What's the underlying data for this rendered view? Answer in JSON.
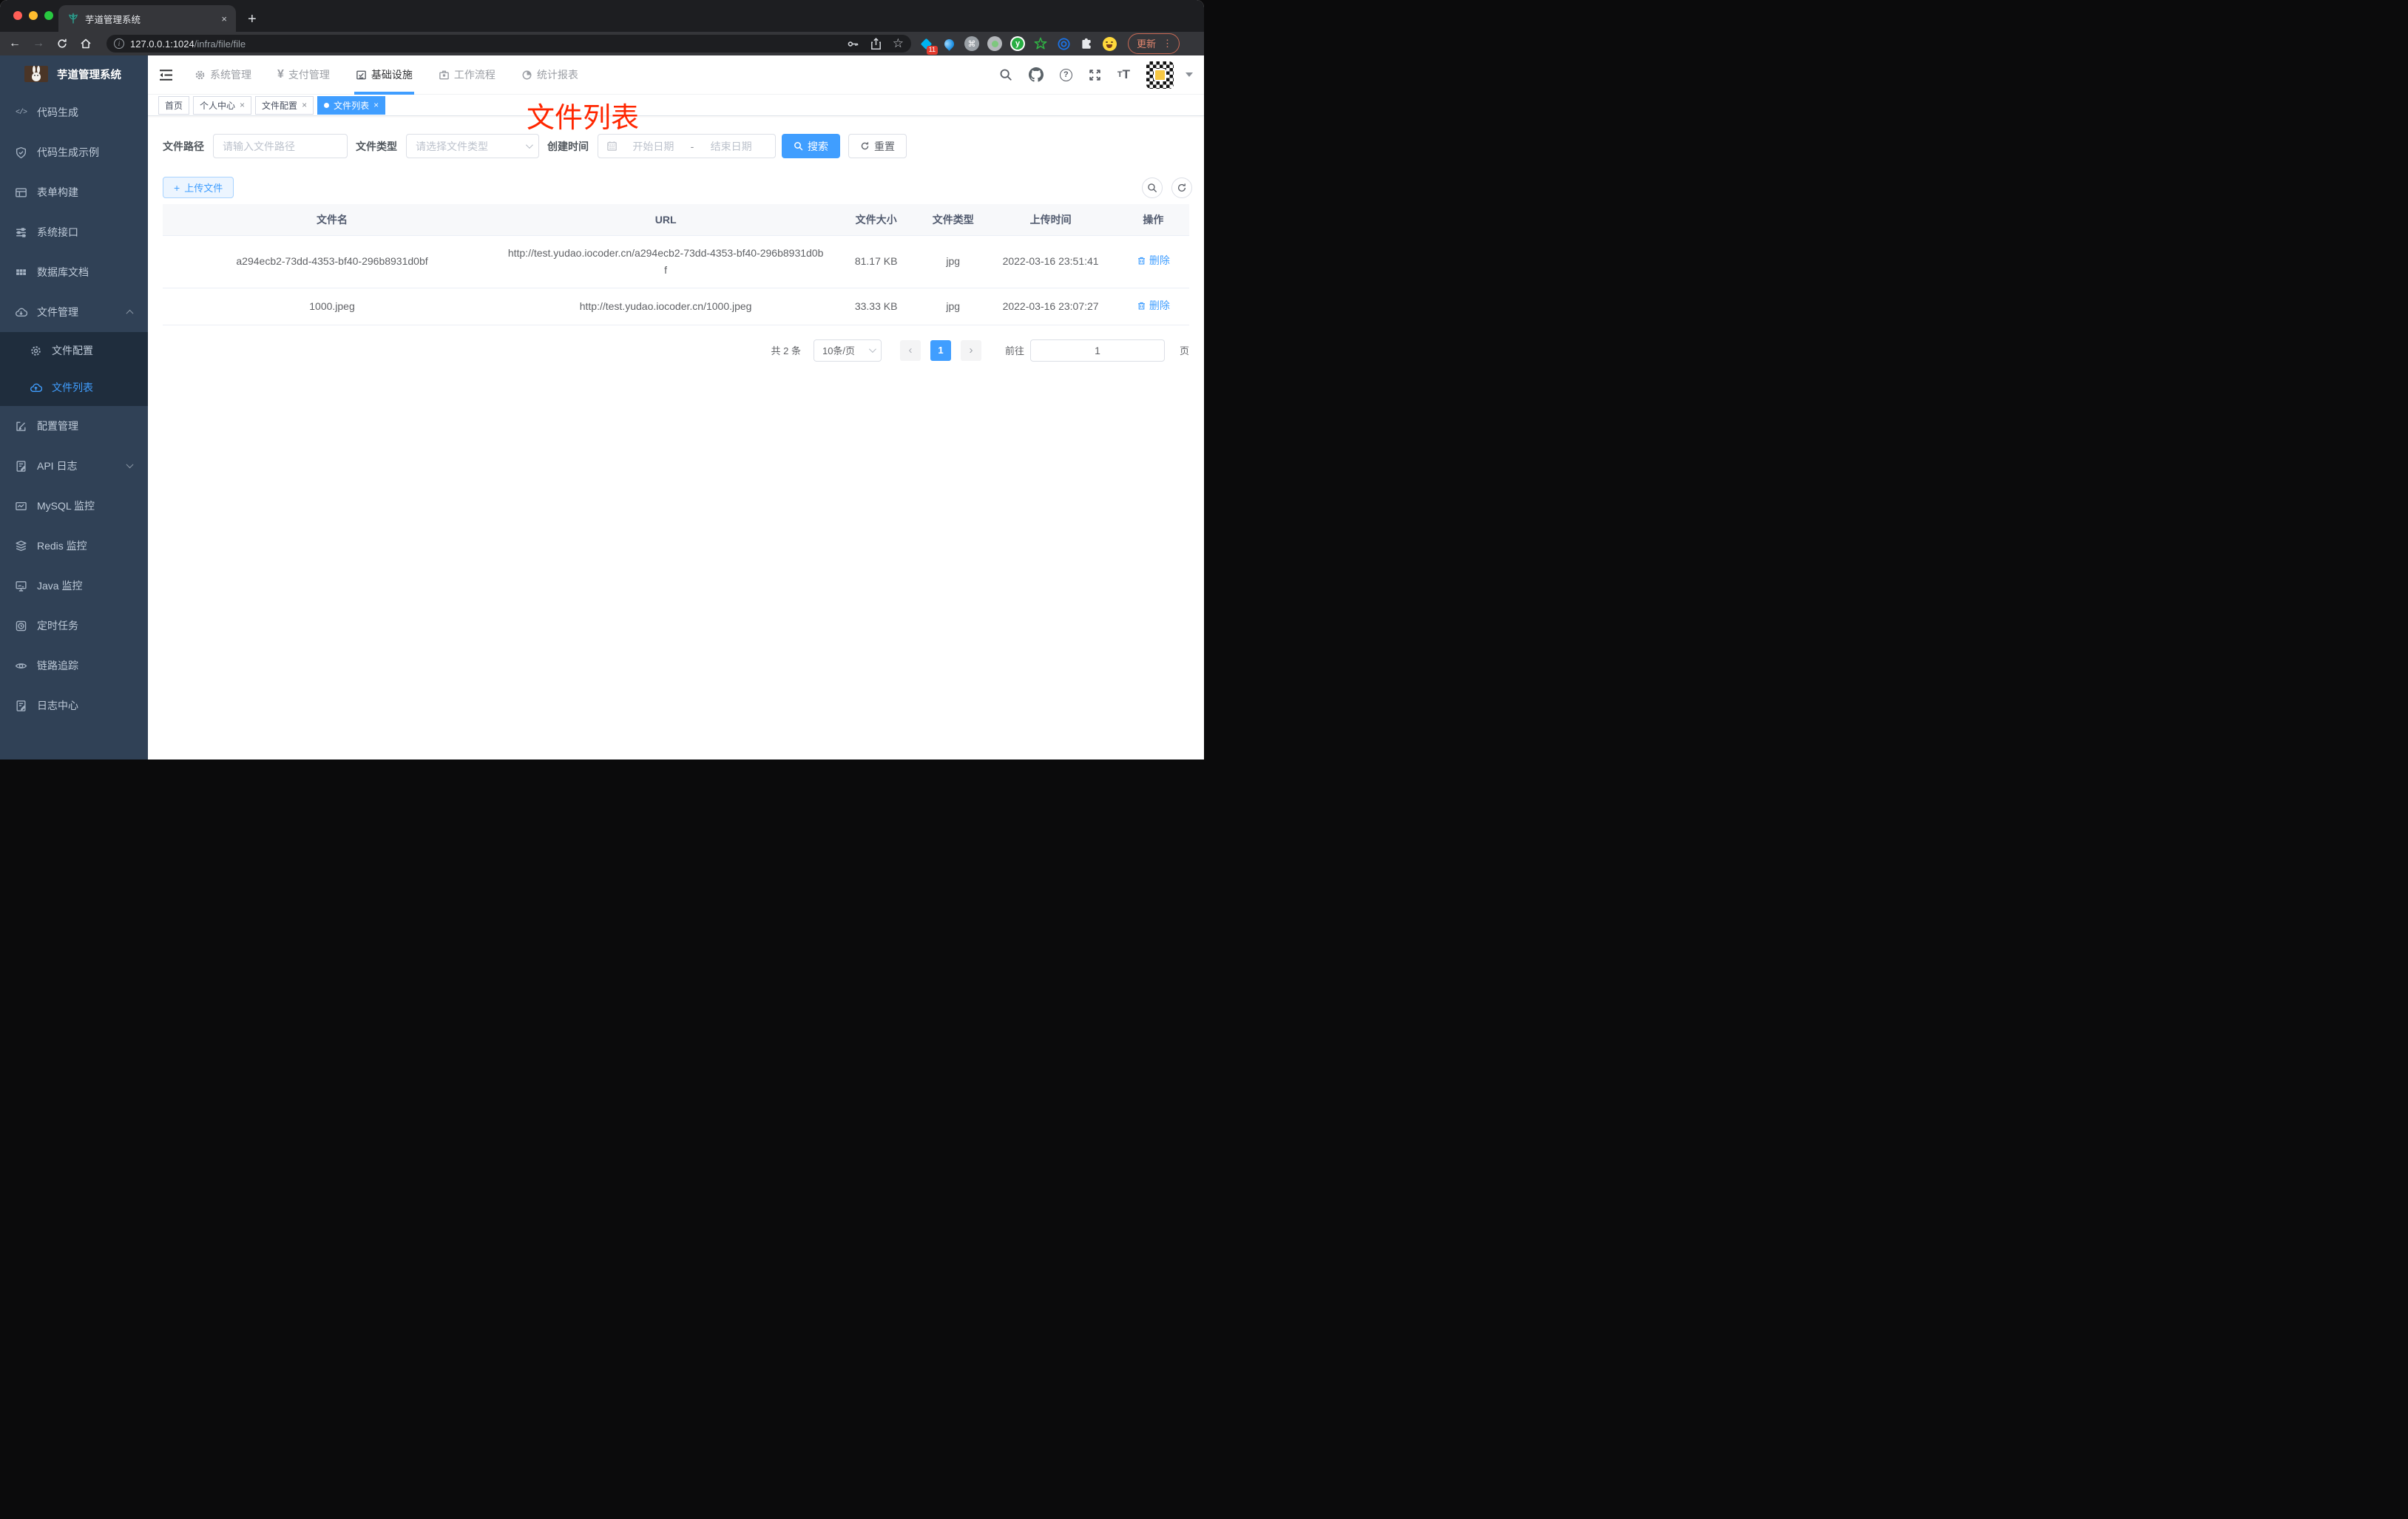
{
  "browser": {
    "tab_title": "芋道管理系统",
    "url_host": "127.0.0.1:1024",
    "url_path": "/infra/file/file",
    "update_label": "更新",
    "extension_badge": "11"
  },
  "icons": {
    "close": "×",
    "plus": "+",
    "back_arrow": "←",
    "forward_arrow": "→",
    "menu_dots": "⋮",
    "command": "⌘",
    "star": "☆",
    "question": "?",
    "info": "i",
    "yen": "¥",
    "dash": "-",
    "prev": "‹",
    "next": "›",
    "text_big": "T",
    "text_small": "T",
    "ext_letter": "y",
    "code": "</>"
  },
  "sidebar": {
    "title": "芋道管理系统",
    "menu": [
      {
        "label": "代码生成"
      },
      {
        "label": "代码生成示例"
      },
      {
        "label": "表单构建"
      },
      {
        "label": "系统接口"
      },
      {
        "label": "数据库文档"
      },
      {
        "label": "文件管理"
      },
      {
        "label": "文件配置"
      },
      {
        "label": "文件列表"
      },
      {
        "label": "配置管理"
      },
      {
        "label": "API 日志"
      },
      {
        "label": "MySQL 监控"
      },
      {
        "label": "Redis 监控"
      },
      {
        "label": "Java 监控"
      },
      {
        "label": "定时任务"
      },
      {
        "label": "链路追踪"
      },
      {
        "label": "日志中心"
      }
    ]
  },
  "topnav": {
    "items": [
      {
        "label": "系统管理"
      },
      {
        "label": "支付管理"
      },
      {
        "label": "基础设施"
      },
      {
        "label": "工作流程"
      },
      {
        "label": "统计报表"
      }
    ]
  },
  "tags": [
    {
      "label": "首页"
    },
    {
      "label": "个人中心"
    },
    {
      "label": "文件配置"
    },
    {
      "label": "文件列表"
    }
  ],
  "annotation": {
    "text": "文件列表",
    "color": "#ff2600"
  },
  "filters": {
    "path_label": "文件路径",
    "path_placeholder": "请输入文件路径",
    "type_label": "文件类型",
    "type_placeholder": "请选择文件类型",
    "time_label": "创建时间",
    "start_placeholder": "开始日期",
    "range_separator": "-",
    "end_placeholder": "结束日期",
    "search_label": "搜索",
    "reset_label": "重置"
  },
  "toolbar": {
    "upload_label": "上传文件"
  },
  "table": {
    "headers": [
      "文件名",
      "URL",
      "文件大小",
      "文件类型",
      "上传时间",
      "操作"
    ],
    "rows": [
      {
        "name": "a294ecb2-73dd-4353-bf40-296b8931d0bf",
        "url": "http://test.yudao.iocoder.cn/a294ecb2-73dd-4353-bf40-296b8931d0bf",
        "size": "81.17 KB",
        "type": "jpg",
        "time": "2022-03-16 23:51:41",
        "action": "删除"
      },
      {
        "name": "1000.jpeg",
        "url": "http://test.yudao.iocoder.cn/1000.jpeg",
        "size": "33.33 KB",
        "type": "jpg",
        "time": "2022-03-16 23:07:27",
        "action": "删除"
      }
    ]
  },
  "pagination": {
    "total": "共 2 条",
    "page_size": "10条/页",
    "current": "1",
    "goto_label": "前往",
    "goto_value": "1",
    "unit": "页"
  },
  "colors": {
    "primary": "#409eff",
    "sidebar_bg": "#304156",
    "submenu_bg": "#1f2d3d",
    "active_tag": "#409eff",
    "annotation_red": "#ff2600",
    "chrome_dark": "#1d1e21",
    "update_accent": "#e2876f"
  }
}
